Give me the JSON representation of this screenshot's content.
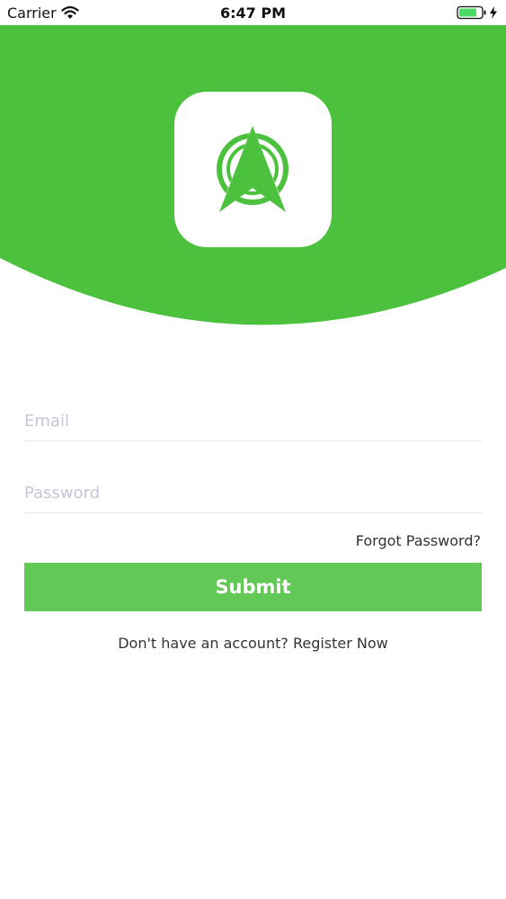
{
  "status_bar": {
    "carrier": "Carrier",
    "time": "6:47 PM"
  },
  "colors": {
    "brand_green": "#4cc13d",
    "button_green": "#62c956"
  },
  "icons": {
    "logo": "navigation-arrow-icon",
    "wifi": "wifi-icon",
    "battery": "battery-charging-icon"
  },
  "form": {
    "email_placeholder": "Email",
    "password_placeholder": "Password",
    "forgot_label": "Forgot Password?",
    "submit_label": "Submit",
    "register_prompt": "Don't have an account?",
    "register_link": "Register Now"
  }
}
